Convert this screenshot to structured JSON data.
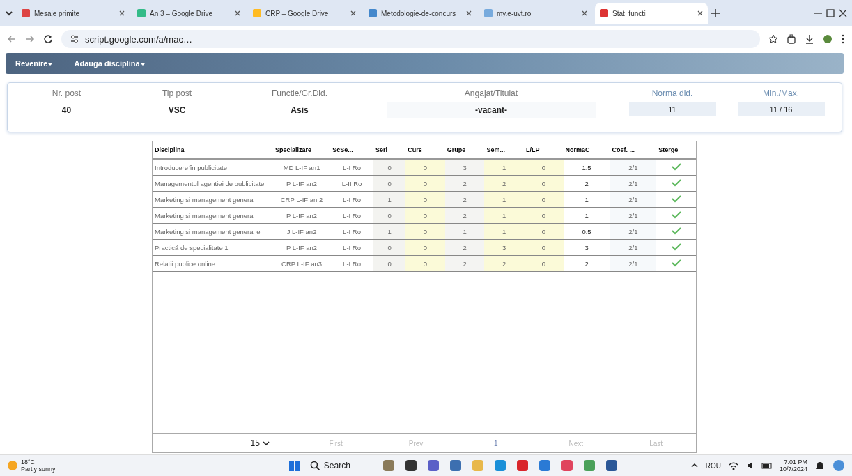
{
  "browser": {
    "tabs": [
      {
        "title": "Mesaje primite",
        "selected": false
      },
      {
        "title": "An 3 – Google Drive",
        "selected": false
      },
      {
        "title": "CRP – Google Drive",
        "selected": false
      },
      {
        "title": "Metodologie-de-concurs",
        "selected": false
      },
      {
        "title": "my.e-uvt.ro",
        "selected": false
      },
      {
        "title": "Stat_functii",
        "selected": true
      }
    ],
    "url": "script.google.com/a/mac…"
  },
  "toolbar": {
    "menus": [
      "Revenire",
      "Adauga disciplina"
    ]
  },
  "post": {
    "fields": [
      {
        "label": "Nr. post",
        "value": "40",
        "kind": "plain"
      },
      {
        "label": "Tip post",
        "value": "VSC",
        "kind": "plain"
      },
      {
        "label": "Functie/Gr.Did.",
        "value": "Asis",
        "kind": "plain"
      },
      {
        "label": "Angajat/Titulat",
        "value": "-vacant-",
        "kind": "wide"
      },
      {
        "label": "Norma did.",
        "value": "11",
        "kind": "boxed"
      },
      {
        "label": "Min./Max.",
        "value": "11 / 16",
        "kind": "boxed"
      }
    ]
  },
  "table": {
    "columns": [
      "Disciplina",
      "Specializare",
      "ScSe...",
      "Seri",
      "Curs",
      "Grupe",
      "Sem...",
      "L/LP",
      "NormaC",
      "Coef. ...",
      "Sterge"
    ],
    "rows": [
      {
        "cells": [
          "Introducere în publicitate",
          "MD L-IF an1",
          "L-I Ro",
          "0",
          "0",
          "3",
          "1",
          "0",
          "1.5",
          "2/1"
        ],
        "checked": true
      },
      {
        "cells": [
          "Managementul agentiei de publicitate",
          "P L-IF an2",
          "L-II Ro",
          "0",
          "0",
          "2",
          "2",
          "0",
          "2",
          "2/1"
        ],
        "checked": true
      },
      {
        "cells": [
          "Marketing si management general",
          "CRP L-IF an 2",
          "L-I Ro",
          "1",
          "0",
          "2",
          "1",
          "0",
          "1",
          "2/1"
        ],
        "checked": true
      },
      {
        "cells": [
          "Marketing si management general",
          "P L-IF an2",
          "L-I Ro",
          "0",
          "0",
          "2",
          "1",
          "0",
          "1",
          "2/1"
        ],
        "checked": true
      },
      {
        "cells": [
          "Marketing si management general e",
          "J L-IF an2",
          "L-I Ro",
          "1",
          "0",
          "1",
          "1",
          "0",
          "0.5",
          "2/1"
        ],
        "checked": true
      },
      {
        "cells": [
          "Practică de specialitate 1",
          "P L-IF an2",
          "L-I Ro",
          "0",
          "0",
          "2",
          "3",
          "0",
          "3",
          "2/1"
        ],
        "checked": true
      },
      {
        "cells": [
          "Relatii publice online",
          "CRP L-IF an3",
          "L-I Ro",
          "0",
          "0",
          "2",
          "2",
          "0",
          "2",
          "2/1"
        ],
        "checked": true
      }
    ],
    "pager": {
      "page_size": "15",
      "links": [
        "First",
        "Prev",
        "1",
        "Next",
        "Last"
      ]
    }
  },
  "taskbar": {
    "temperature": "18°C",
    "weather": "Partly sunny",
    "search": "Search",
    "language": "ROU",
    "time": "7:01 PM",
    "date": "10/7/2024"
  }
}
